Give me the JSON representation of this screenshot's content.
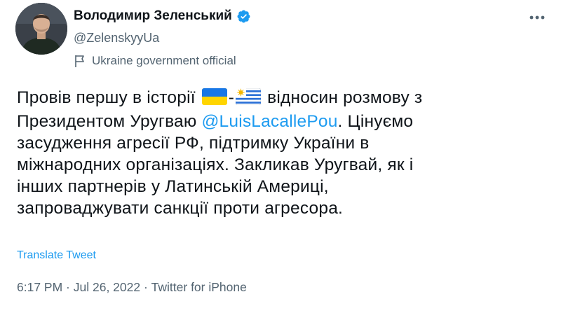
{
  "author": {
    "display_name": "Володимир Зеленський",
    "handle": "@ZelenskyyUa",
    "affiliation": "Ukraine government official",
    "avatar_icon": "profile-photo",
    "verified_icon": "verified-badge-icon"
  },
  "tweet": {
    "line1_pre": "Провів першу в історії ",
    "line1_dash": "-",
    "line1_post": " відносин розмову з",
    "line2_pre": "Президентом Уругваю ",
    "line2_mention": "@LuisLacallePou",
    "line2_post": ". Цінуємо",
    "line3": "засудження агресії РФ, підтримку України в",
    "line4": "міжнародних організаціях. Закликав Уругвай, як і",
    "line5": "інших партнерів у Латинській Америці,",
    "line6": "запроваджувати санкції проти агресора.",
    "flags": [
      "Ukraine flag emoji",
      "Uruguay flag emoji"
    ]
  },
  "translate_label": "Translate Tweet",
  "meta": {
    "time": "6:17 PM",
    "sep1": " · ",
    "date": "Jul 26, 2022",
    "sep2": " · ",
    "source": "Twitter for iPhone"
  },
  "colors": {
    "text": "#0f1419",
    "secondary": "#536471",
    "link": "#1d9bf0"
  }
}
